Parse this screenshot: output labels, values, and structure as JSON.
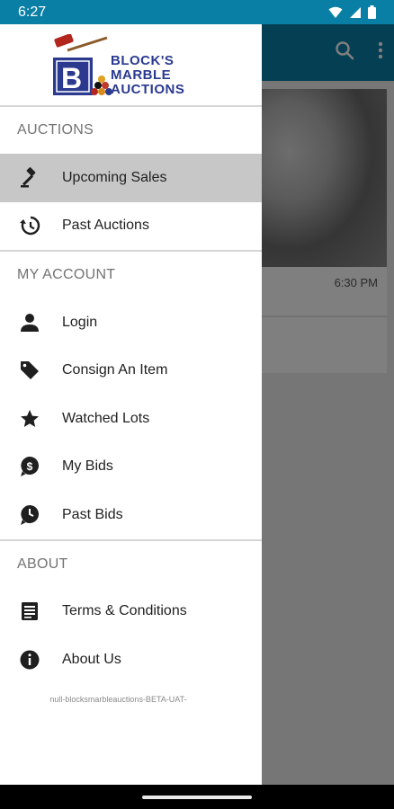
{
  "status_bar": {
    "time": "6:27"
  },
  "logo": {
    "text_lines": [
      "BLOCK'S",
      "MARBLE",
      "AUCTIONS"
    ],
    "brand_color": "#2b3a8f",
    "accent_color": "#b3261e"
  },
  "drawer": {
    "sections": [
      {
        "header": "AUCTIONS",
        "items": [
          {
            "label": "Upcoming Sales",
            "icon": "gavel-icon",
            "active": true
          },
          {
            "label": "Past Auctions",
            "icon": "history-icon",
            "active": false
          }
        ]
      },
      {
        "header": "MY ACCOUNT",
        "items": [
          {
            "label": "Login",
            "icon": "person-icon"
          },
          {
            "label": "Consign An Item",
            "icon": "tag-icon"
          },
          {
            "label": "Watched Lots",
            "icon": "star-icon"
          },
          {
            "label": "My Bids",
            "icon": "dollar-pin-icon"
          },
          {
            "label": "Past Bids",
            "icon": "clock-pin-icon"
          }
        ]
      },
      {
        "header": "ABOUT",
        "items": [
          {
            "label": "Terms & Conditions",
            "icon": "document-icon"
          },
          {
            "label": "About Us",
            "icon": "info-icon"
          }
        ]
      }
    ],
    "footer": "null-blocksmarbleauctions-BETA-UAT-"
  },
  "background_app": {
    "card_time": "6:30 PM",
    "toolbar_color": "#0a7fa6"
  }
}
